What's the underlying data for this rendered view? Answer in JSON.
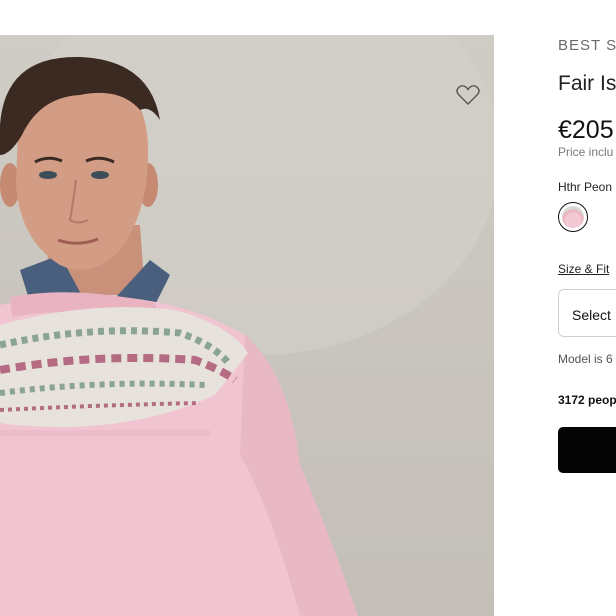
{
  "product": {
    "badge": "BEST SE",
    "title": "Fair Isl",
    "price": "€205",
    "price_note": "Price inclu",
    "color_name": "Hthr Peon",
    "size_fit_link": "Size & Fit",
    "size_select": "Select",
    "model_note": "Model is 6",
    "popularity": "3172 peop"
  },
  "icons": {
    "favorite": "heart-outline-icon"
  },
  "colors": {
    "background": "#ffffff",
    "photo_background": "#cbc7c0",
    "sweater": "#f0c4d0",
    "button": "#050505"
  }
}
